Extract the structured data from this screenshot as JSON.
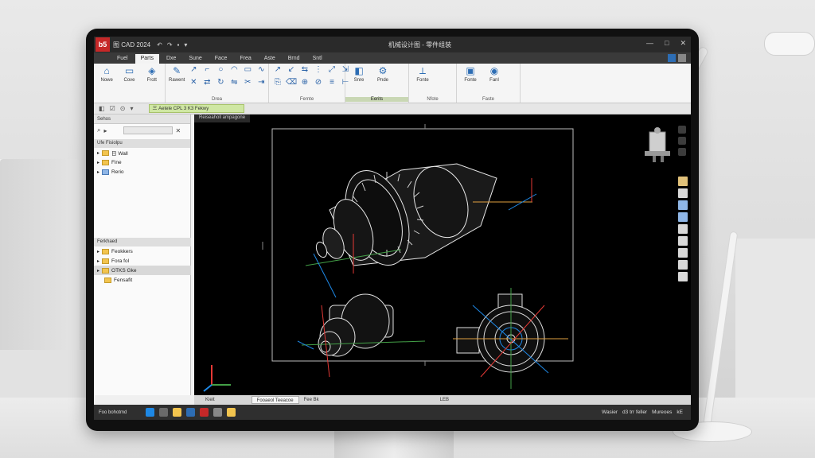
{
  "app": {
    "logo_text": "b5",
    "name": "图 CAD 2024",
    "window_title": "机械设计图 - 零件组装",
    "win_controls": [
      "—",
      "□",
      "✕"
    ]
  },
  "ribbon_tabs": [
    {
      "label": "Fuel",
      "active": false
    },
    {
      "label": "Parts",
      "active": true
    },
    {
      "label": "Dxe",
      "active": false
    },
    {
      "label": "Sune",
      "active": false
    },
    {
      "label": "Face",
      "active": false
    },
    {
      "label": "Frea",
      "active": false
    },
    {
      "label": "Aste",
      "active": false
    },
    {
      "label": "Brnd",
      "active": false
    },
    {
      "label": "Sntl",
      "active": false
    }
  ],
  "ribbon": {
    "group1": {
      "buttons": [
        {
          "label": "Nowe",
          "icon": "home-icon"
        },
        {
          "label": "Cove",
          "icon": "document-icon"
        },
        {
          "label": "Frott",
          "icon": "cube-icon"
        }
      ],
      "label": ""
    },
    "group2": {
      "label": "Drea",
      "big": {
        "label": "Rawent",
        "icon": "pen-icon"
      }
    },
    "group3": {
      "label": "Fernte"
    },
    "group4": {
      "label": "Eerits",
      "buttons": [
        {
          "label": "Snre",
          "icon": "shape-icon"
        },
        {
          "label": "Pnde",
          "icon": "gear-icon"
        }
      ]
    },
    "group5": {
      "label": "Nfote",
      "buttons": [
        {
          "label": "Fonte",
          "icon": "tool-icon"
        }
      ]
    },
    "group6": {
      "label": "Faste",
      "buttons": [
        {
          "label": "Fonte",
          "icon": "box-icon"
        },
        {
          "label": "Fanl",
          "icon": "light-icon"
        }
      ]
    }
  },
  "command": {
    "input_text": "三 Aetele CPL 3 K3 Fekwy"
  },
  "browser": {
    "header": "Sehos",
    "tree1_header": "Ufe Fisiolpu",
    "tree1": [
      "日 Wall",
      "Fine",
      "Rerio"
    ],
    "panel2_header": "Ferkhaed",
    "tree2": [
      "Feokkers",
      "Fora fol",
      "OTKS Gke",
      "Fensafit"
    ]
  },
  "canvas": {
    "tab_label": "Reiseaholl ampagone"
  },
  "sheetbar": {
    "tabs": [
      "Kieit",
      "Fooaeol Teeacoe",
      "Fee Bk"
    ],
    "page_label": "LEB"
  },
  "statusbar": {
    "left": "Foo bohotmd",
    "right_items": [
      "Wasier",
      "d3 trr feller",
      "Mureoes",
      "kE"
    ]
  },
  "colors": {
    "accent": "#2d6db4",
    "canvas_bg": "#000000",
    "cmd_input_bg": "#cfe7a3",
    "logo": "#c62828"
  }
}
